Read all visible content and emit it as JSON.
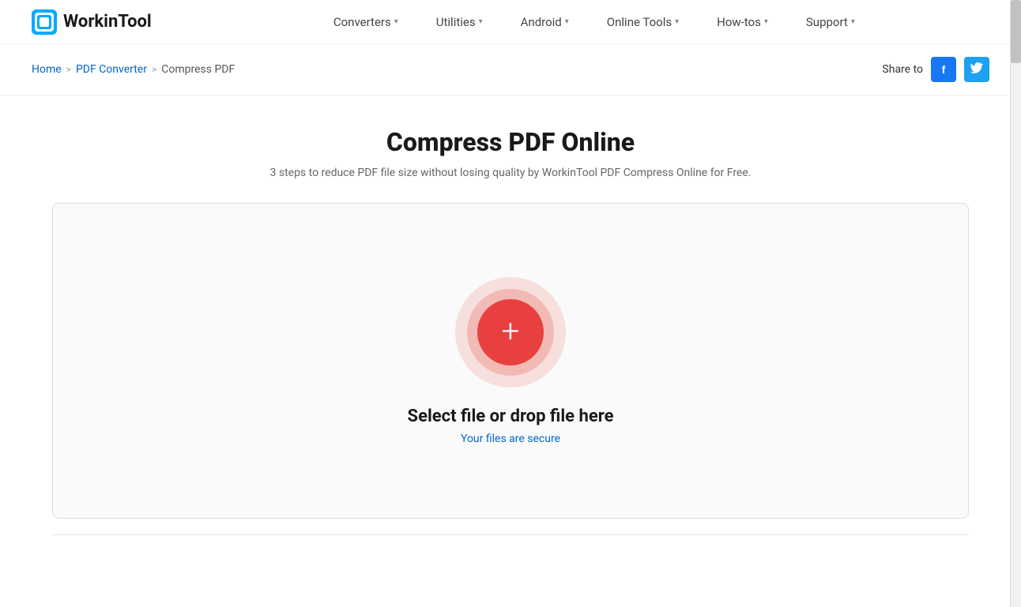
{
  "brand": {
    "name": "WorkinTool",
    "logo_alt": "WorkinTool logo"
  },
  "nav": {
    "items": [
      {
        "label": "Converters",
        "has_chevron": true
      },
      {
        "label": "Utilities",
        "has_chevron": true
      },
      {
        "label": "Android",
        "has_chevron": true
      },
      {
        "label": "Online Tools",
        "has_chevron": true
      },
      {
        "label": "How-tos",
        "has_chevron": true
      },
      {
        "label": "Support",
        "has_chevron": true
      }
    ]
  },
  "breadcrumb": {
    "home": "Home",
    "separator1": ">",
    "pdf_converter": "PDF Converter",
    "separator2": ">",
    "current": "Compress PDF"
  },
  "share": {
    "label": "Share to"
  },
  "page": {
    "title": "Compress PDF Online",
    "subtitle": "3 steps to reduce PDF file size without losing quality by WorkinTool PDF Compress Online for Free."
  },
  "upload": {
    "main_text": "Select file or drop file here",
    "secure_text": "Your files are secure",
    "plus_symbol": "+"
  },
  "colors": {
    "facebook": "#1877F2",
    "twitter": "#1DA1F2",
    "upload_btn": "#e84040",
    "link_blue": "#0066cc"
  }
}
